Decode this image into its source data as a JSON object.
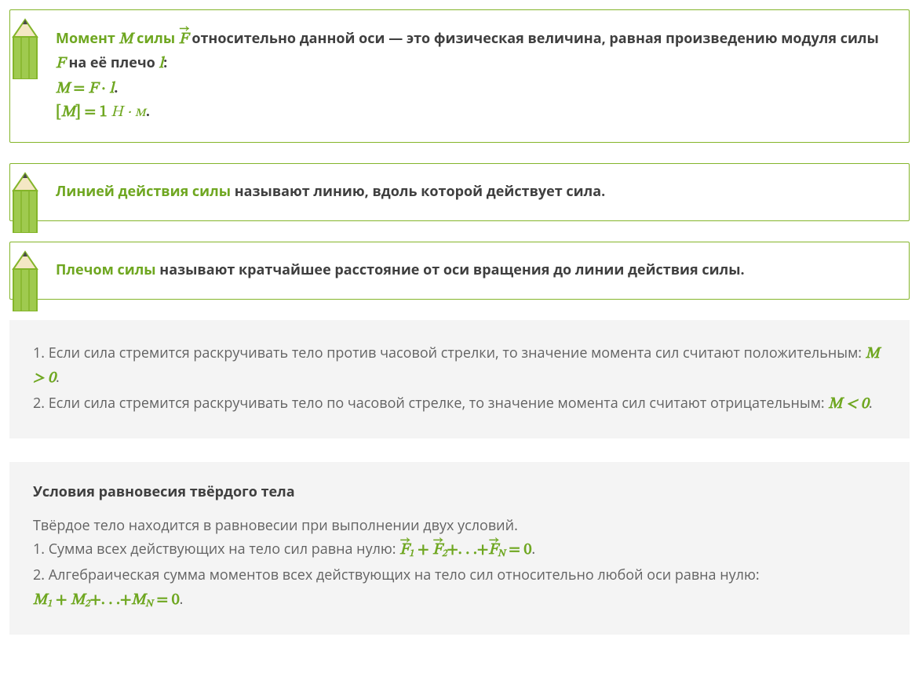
{
  "card1": {
    "t1_a": "Момент ",
    "t1_M": "M",
    "t1_b": " силы ",
    "t1_F": "F",
    "t1_c": " относительно данной оси — это физическая величина, равная произведению модуля силы ",
    "t1_F2": "F",
    "t1_d": " на её плечо ",
    "t1_l": "l",
    "t1_e": ":",
    "eq1_lhs": "M",
    "eq1_eq": " = ",
    "eq1_rhs_F": "F",
    "eq1_dot": " · ",
    "eq1_rhs_l": "l",
    "eq1_period": ".",
    "eq2_open": "[",
    "eq2_M": "M",
    "eq2_close": "]",
    "eq2_eq": " = ",
    "eq2_one": "1",
    "eq2_units": " Н · м",
    "eq2_period": "."
  },
  "card2": {
    "lead": "Линией действия силы",
    "tail": " называют линию, вдоль которой действует сила."
  },
  "card3": {
    "lead": "Плечом силы",
    "tail": " называют кратчайшее расстояние от оси вращения до линии действия силы."
  },
  "note1": {
    "p1a": "1. Если сила стремится раскручивать тело против часовой стрелки, то значение момента сил считают положительным: ",
    "p1m": "M > 0",
    "p1b": ".",
    "p2a": "2. Если сила стремится раскручивать тело по часовой стрелке, то значение момента сил считают отрицательным: ",
    "p2m": "M < 0",
    "p2b": "."
  },
  "note2": {
    "title": "Условия равновесия твёрдого тела",
    "p0": "Твёрдое тело находится в равновесии при выполнении двух условий.",
    "p1a": "1. Сумма всех действующих на тело сил равна нулю: ",
    "p1_F": "F",
    "p1_s1": "1",
    "p1_plus": " + ",
    "p1_F2": "F",
    "p1_s2": "2",
    "p1_dots": "+. . .+",
    "p1_FN": "F",
    "p1_sN": "N",
    "p1_eq0": " = 0",
    "p1b": ".",
    "p2a": "2. Алгебраическая сумма моментов всех действующих на тело сил относительно любой оси равна нулю:",
    "p2_M1": "M",
    "p2_s1": "1",
    "p2_plus": " + ",
    "p2_M2": "M",
    "p2_s2": "2",
    "p2_dots": "+. . .+",
    "p2_MN": "M",
    "p2_sN": "N",
    "p2_eq0": " = 0",
    "p2b": "."
  }
}
